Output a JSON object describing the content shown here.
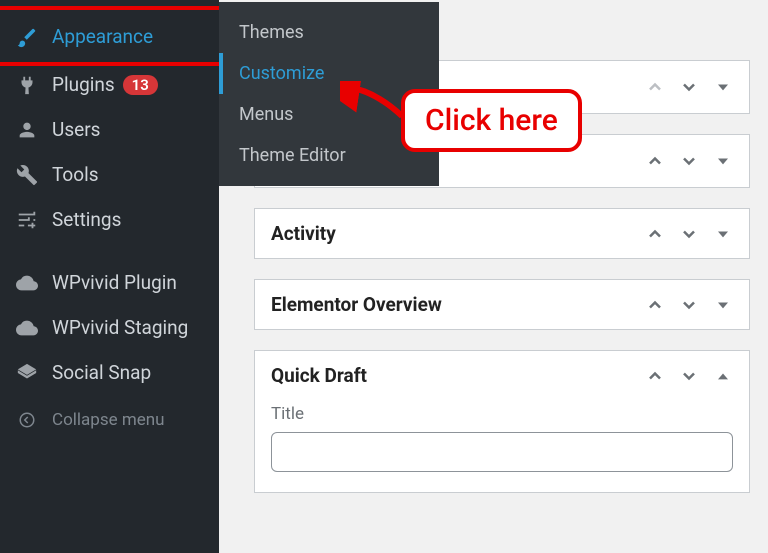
{
  "sidebar": {
    "appearance": "Appearance",
    "plugins": "Plugins",
    "plugins_badge": "13",
    "users": "Users",
    "tools": "Tools",
    "settings": "Settings",
    "wpvivid_plugin": "WPvivid Plugin",
    "wpvivid_staging": "WPvivid Staging",
    "social_snap": "Social Snap",
    "collapse": "Collapse menu"
  },
  "submenu": {
    "themes": "Themes",
    "customize": "Customize",
    "menus": "Menus",
    "theme_editor": "Theme Editor"
  },
  "panels": {
    "activity": "Activity",
    "elementor": "Elementor Overview",
    "quick_draft": "Quick Draft",
    "title_label": "Title"
  },
  "callout": "Click here"
}
